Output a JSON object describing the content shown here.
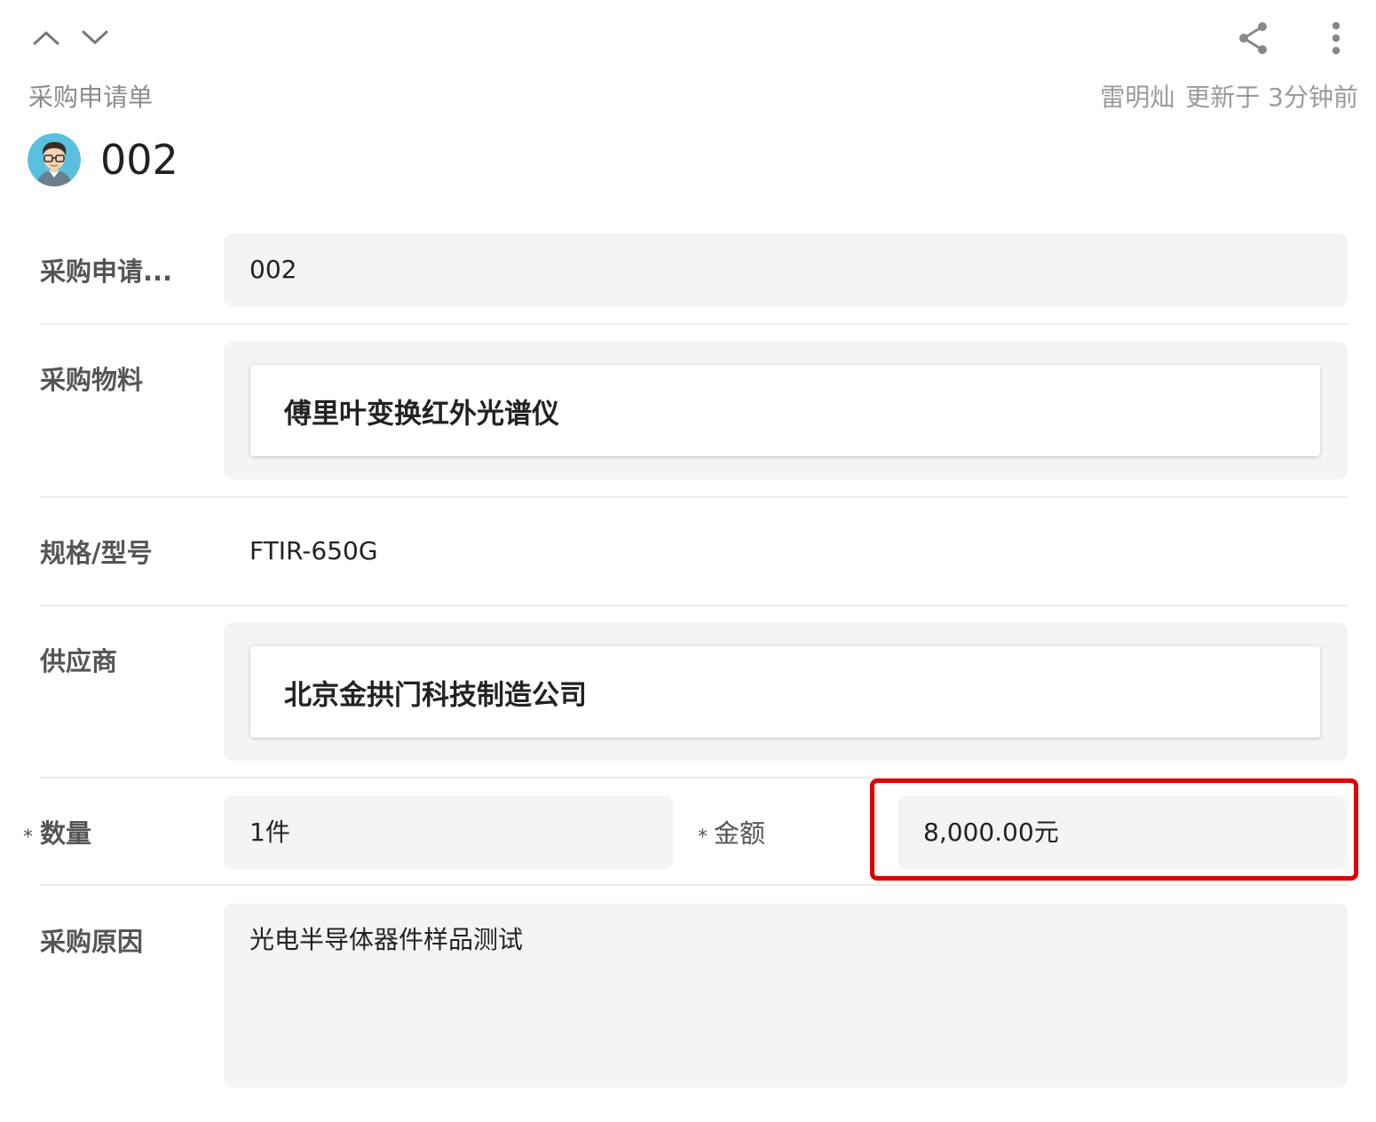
{
  "toolbar": {
    "prev_icon": "chevron-up-icon",
    "next_icon": "chevron-down-icon",
    "share_icon": "share-icon",
    "more_icon": "more-vertical-icon"
  },
  "header": {
    "section_title": "采购申请单",
    "updated_by": "雷明灿",
    "updated_text": "更新于 3分钟前",
    "record_title": "002",
    "avatar_icon": "user-avatar"
  },
  "fields": {
    "request_no": {
      "label": "采购申请...",
      "value": "002"
    },
    "material": {
      "label": "采购物料",
      "value": "傅里叶变换红外光谱仪"
    },
    "spec": {
      "label": "规格/型号",
      "value": "FTIR-650G"
    },
    "supplier": {
      "label": "供应商",
      "value": "北京金拱门科技制造公司"
    },
    "quantity": {
      "required_mark": "*",
      "label": "数量",
      "value": "1件"
    },
    "amount": {
      "required_mark": "*",
      "label": "金额",
      "value": "8,000.00元"
    },
    "reason": {
      "label": "采购原因",
      "value": "光电半导体器件样品测试"
    }
  },
  "colors": {
    "highlight": "#e00000",
    "field_bg": "#f4f4f4",
    "muted_text": "#8c8c8c"
  }
}
